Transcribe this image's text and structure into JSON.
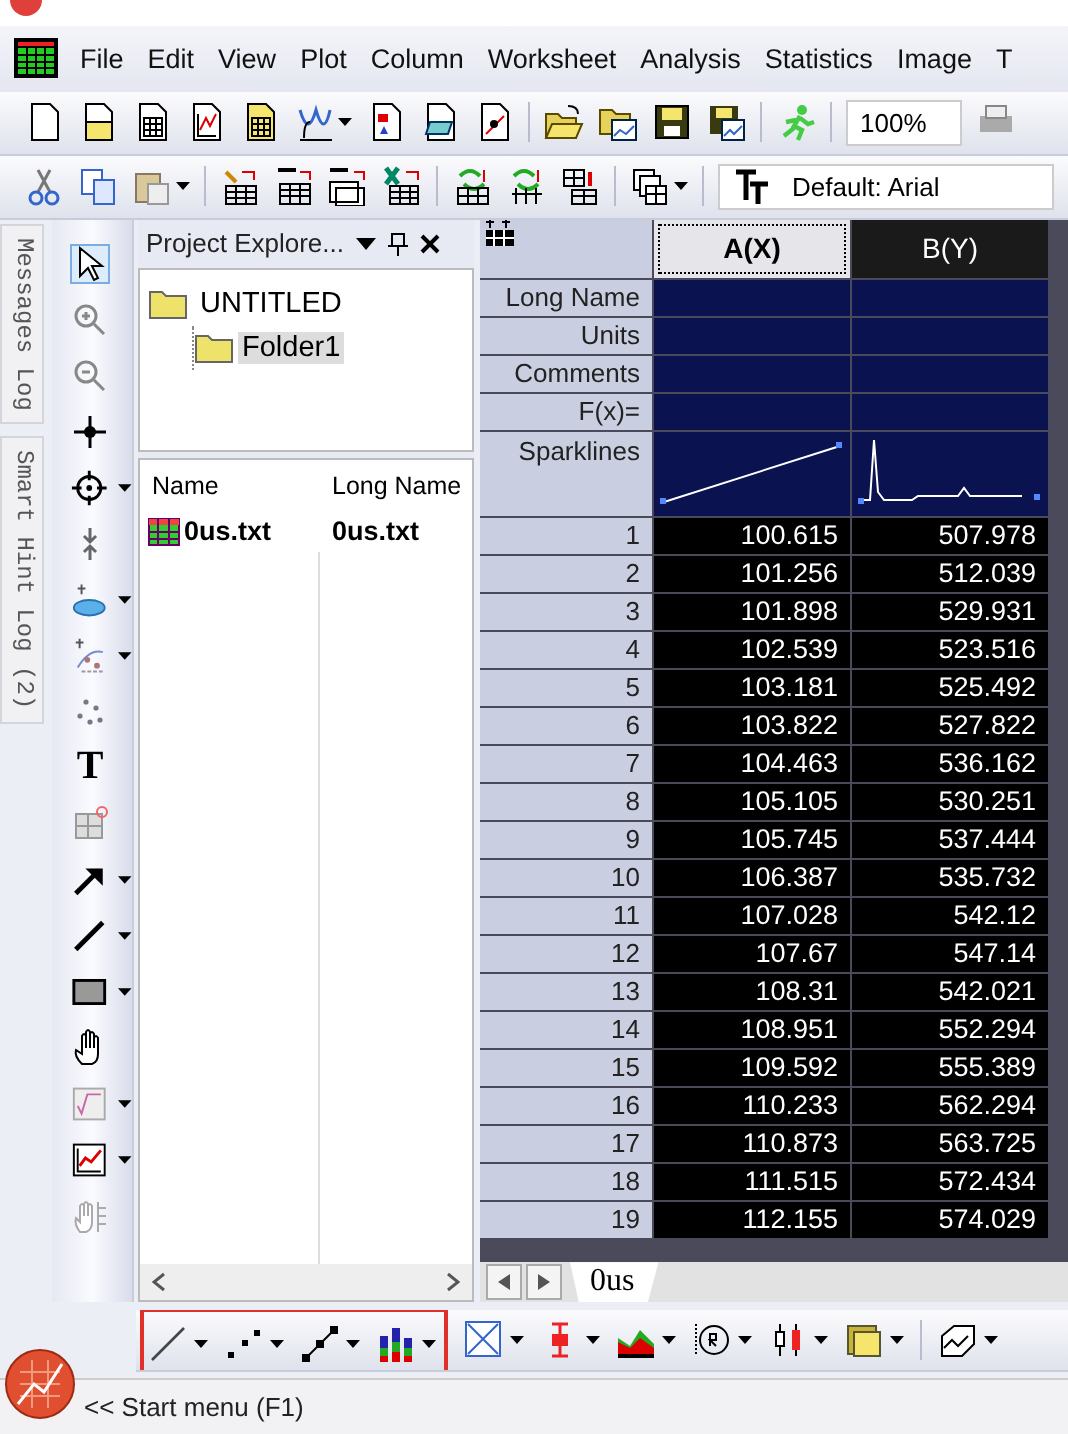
{
  "menu": {
    "items": [
      "File",
      "Edit",
      "View",
      "Plot",
      "Column",
      "Worksheet",
      "Analysis",
      "Statistics",
      "Image",
      "T"
    ]
  },
  "toolbar": {
    "zoom": "100%",
    "font": "Default: Arial"
  },
  "side_tabs": [
    "Messages Log",
    "Smart Hint Log (2)"
  ],
  "tools": [
    {
      "kind": "pointer",
      "selected": true,
      "dropdown": false
    },
    {
      "kind": "zoom-in",
      "selected": false,
      "dropdown": false
    },
    {
      "kind": "zoom-out",
      "selected": false,
      "dropdown": false
    },
    {
      "kind": "crosshair",
      "selected": false,
      "dropdown": false
    },
    {
      "kind": "target",
      "selected": false,
      "dropdown": true
    },
    {
      "kind": "reader",
      "selected": false,
      "dropdown": false
    },
    {
      "kind": "mask",
      "selected": false,
      "dropdown": true
    },
    {
      "kind": "scatter-mask",
      "selected": false,
      "dropdown": true
    },
    {
      "kind": "dots",
      "selected": false,
      "dropdown": false
    },
    {
      "kind": "text",
      "label": "T",
      "selected": false,
      "dropdown": false
    },
    {
      "kind": "region",
      "selected": false,
      "dropdown": false
    },
    {
      "kind": "arrow",
      "selected": false,
      "dropdown": true
    },
    {
      "kind": "line",
      "selected": false,
      "dropdown": true
    },
    {
      "kind": "rect",
      "selected": false,
      "dropdown": true
    },
    {
      "kind": "hand",
      "selected": false,
      "dropdown": false
    },
    {
      "kind": "equation",
      "selected": false,
      "dropdown": true
    },
    {
      "kind": "graph",
      "selected": false,
      "dropdown": true
    },
    {
      "kind": "hand-grid",
      "selected": false,
      "dropdown": false
    }
  ],
  "project_explorer": {
    "title": "Project Explore...",
    "tree": [
      {
        "label": "UNTITLED",
        "selected": false,
        "children": [
          {
            "label": "Folder1",
            "selected": true
          }
        ]
      }
    ],
    "columns": [
      "Name",
      "Long Name"
    ],
    "files": [
      {
        "name": "0us.txt",
        "long_name": "0us.txt"
      }
    ]
  },
  "worksheet": {
    "columns": [
      {
        "label": "A(X)",
        "selected": false
      },
      {
        "label": "B(Y)",
        "selected": true
      }
    ],
    "header_rows": [
      "Long Name",
      "Units",
      "Comments",
      "F(x)=",
      "Sparklines"
    ],
    "rows": [
      {
        "index": "1",
        "values": [
          "100.615",
          "507.978"
        ]
      },
      {
        "index": "2",
        "values": [
          "101.256",
          "512.039"
        ]
      },
      {
        "index": "3",
        "values": [
          "101.898",
          "529.931"
        ]
      },
      {
        "index": "4",
        "values": [
          "102.539",
          "523.516"
        ]
      },
      {
        "index": "5",
        "values": [
          "103.181",
          "525.492"
        ]
      },
      {
        "index": "6",
        "values": [
          "103.822",
          "527.822"
        ]
      },
      {
        "index": "7",
        "values": [
          "104.463",
          "536.162"
        ]
      },
      {
        "index": "8",
        "values": [
          "105.105",
          "530.251"
        ]
      },
      {
        "index": "9",
        "values": [
          "105.745",
          "537.444"
        ]
      },
      {
        "index": "10",
        "values": [
          "106.387",
          "535.732"
        ]
      },
      {
        "index": "11",
        "values": [
          "107.028",
          "542.12"
        ]
      },
      {
        "index": "12",
        "values": [
          "107.67",
          "547.14"
        ]
      },
      {
        "index": "13",
        "values": [
          "108.31",
          "542.021"
        ]
      },
      {
        "index": "14",
        "values": [
          "108.951",
          "552.294"
        ]
      },
      {
        "index": "15",
        "values": [
          "109.592",
          "555.389"
        ]
      },
      {
        "index": "16",
        "values": [
          "110.233",
          "562.294"
        ]
      },
      {
        "index": "17",
        "values": [
          "110.873",
          "563.725"
        ]
      },
      {
        "index": "18",
        "values": [
          "111.515",
          "572.434"
        ]
      },
      {
        "index": "19",
        "values": [
          "112.155",
          "574.029"
        ]
      }
    ],
    "sheet_tab": "0us"
  },
  "status_bar": {
    "text": "<< Start menu (F1)"
  }
}
